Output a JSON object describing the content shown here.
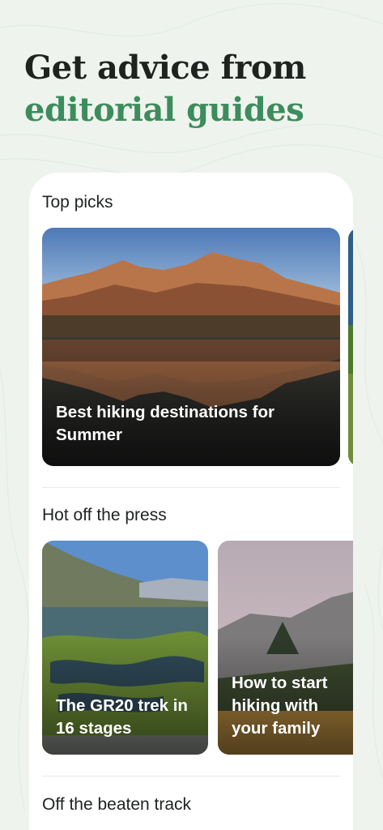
{
  "headline": {
    "line1": "Get advice from",
    "line2": "editorial guides"
  },
  "sections": [
    {
      "title": "Top picks",
      "cards": [
        {
          "label": "Best hiking destinations for Summer"
        }
      ]
    },
    {
      "title": "Hot off the press",
      "cards": [
        {
          "label": "The GR20 trek in 16 stages"
        },
        {
          "label": "How to start hiking with your family"
        }
      ]
    },
    {
      "title": "Off the beaten track"
    }
  ],
  "colors": {
    "background": "#eef3ee",
    "headline_dark": "#1f2320",
    "headline_accent": "#3d8c5c"
  }
}
